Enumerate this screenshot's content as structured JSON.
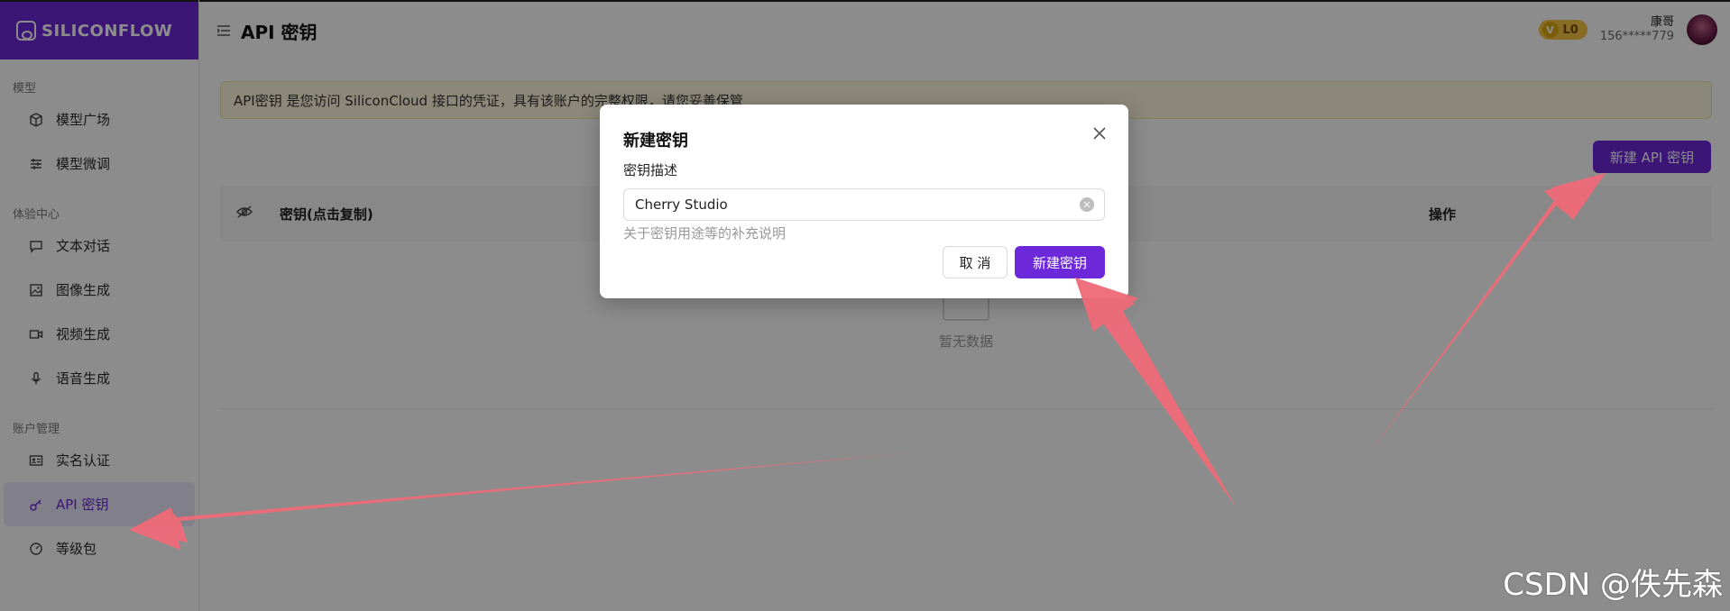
{
  "brand": {
    "name": "SILICONFLOW"
  },
  "sidebar": {
    "sections": [
      {
        "title": "模型",
        "items": [
          {
            "label": "模型广场",
            "icon": "cube-icon"
          },
          {
            "label": "模型微调",
            "icon": "sliders-icon"
          }
        ]
      },
      {
        "title": "体验中心",
        "items": [
          {
            "label": "文本对话",
            "icon": "chat-icon"
          },
          {
            "label": "图像生成",
            "icon": "image-icon"
          },
          {
            "label": "视频生成",
            "icon": "video-icon"
          },
          {
            "label": "语音生成",
            "icon": "mic-icon"
          }
        ]
      },
      {
        "title": "账户管理",
        "items": [
          {
            "label": "实名认证",
            "icon": "id-card-icon"
          },
          {
            "label": "API 密钥",
            "icon": "key-icon",
            "active": true
          },
          {
            "label": "等级包",
            "icon": "gauge-icon"
          }
        ]
      }
    ]
  },
  "header": {
    "title": "API 密钥",
    "vip_level": "L0",
    "vip_letter": "V",
    "user_name": "康哥",
    "user_phone": "156*****779"
  },
  "notice": {
    "text": "API密钥 是您访问 SiliconCloud 接口的凭证，具有该账户的完整权限，请您妥善保管"
  },
  "main": {
    "new_key_button": "新建 API 密钥",
    "table": {
      "col_key": "密钥(点击复制)",
      "col_actions": "操作",
      "empty_text": "暂无数据"
    }
  },
  "modal": {
    "title": "新建密钥",
    "field_label": "密钥描述",
    "field_value": "Cherry Studio",
    "field_hint": "关于密钥用途等的补充说明",
    "cancel_label": "取 消",
    "create_label": "新建密钥"
  },
  "watermark": "CSDN @佚先森",
  "colors": {
    "accent": "#6d28d9",
    "arrow": "#f06a78",
    "notice_bg": "#fdf6dc",
    "vip_gold": "#f5c542"
  }
}
